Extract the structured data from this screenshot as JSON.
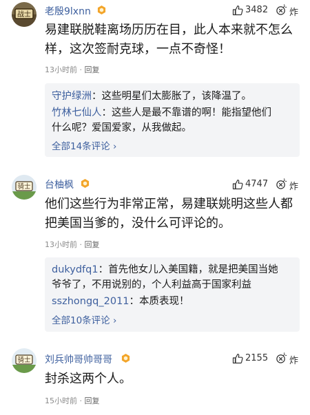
{
  "comments": [
    {
      "username": "老殷9lxnn",
      "avatar_text": "战士",
      "likes": "3482",
      "zha": "炸",
      "text_lines": [
        "易建联脱鞋离场历历在目，此人本来就不怎么",
        "样，这次签耐克球，一点不奇怪！"
      ],
      "time": "13小时前",
      "separator": "·",
      "reply_label": "回复",
      "replies": [
        {
          "user": "守护绿洲",
          "sep": "：",
          "text_lines": [
            "这些明星们太膨胀了，该降温了。"
          ]
        },
        {
          "user": "竹林七仙人",
          "sep": "：",
          "text_lines": [
            "这些人是最不靠谱的啊！能指望他们",
            "什么呢？爱国爱家，从我做起。"
          ]
        }
      ],
      "all_replies": "全部14条评论",
      "chevron": "›"
    },
    {
      "username": "台柚枫",
      "avatar_text": "骑士",
      "likes": "4747",
      "zha": "炸",
      "text_lines": [
        "他们这些行为非常正常，易建联姚明这些人都",
        "把美国当爹的，没什么可评论的。"
      ],
      "time": "13小时前",
      "separator": "·",
      "reply_label": "回复",
      "replies": [
        {
          "user": "dukydfq1",
          "sep": "：",
          "text_lines": [
            "首先他女儿入美国籍，就是把美国当她",
            "爷爷了，不用说别的，个人利益高于国家利益"
          ]
        },
        {
          "user": "sszhongq_2011",
          "sep": "：",
          "text_lines": [
            "本质表现！"
          ]
        }
      ],
      "all_replies": "全部10条评论",
      "chevron": "›"
    },
    {
      "username": "刘兵帅哥帅哥哥",
      "avatar_text": "骑士",
      "likes": "2155",
      "zha": "炸",
      "text_lines": [
        "封杀这两个人。"
      ],
      "time": "15小时前",
      "separator": "·",
      "reply_label": "回复"
    }
  ]
}
